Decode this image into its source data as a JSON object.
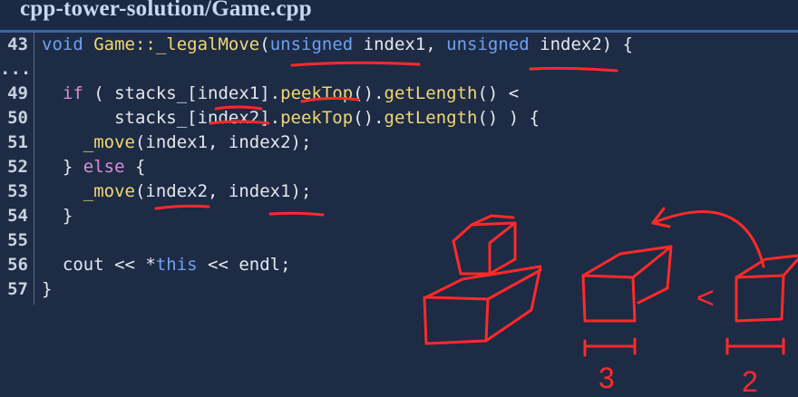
{
  "header": {
    "file_title": "cpp-tower-solution/Game.cpp"
  },
  "editor": {
    "lines": [
      {
        "num": "43",
        "tokens": [
          {
            "t": "void",
            "c": "kw"
          },
          {
            "t": " ",
            "c": "pl"
          },
          {
            "t": "Game::_legalMove",
            "c": "fn"
          },
          {
            "t": "(",
            "c": "pl"
          },
          {
            "t": "unsigned",
            "c": "kw"
          },
          {
            "t": " index1, ",
            "c": "pl"
          },
          {
            "t": "unsigned",
            "c": "kw"
          },
          {
            "t": " index2) {",
            "c": "pl"
          }
        ]
      },
      {
        "num": "...",
        "tokens": []
      },
      {
        "num": "49",
        "tokens": [
          {
            "t": "  ",
            "c": "pl"
          },
          {
            "t": "if",
            "c": "cf"
          },
          {
            "t": " ( stacks_[index1].",
            "c": "pl"
          },
          {
            "t": "peekTop",
            "c": "fn"
          },
          {
            "t": "().",
            "c": "pl"
          },
          {
            "t": "getLength",
            "c": "fn"
          },
          {
            "t": "() <",
            "c": "pl"
          }
        ]
      },
      {
        "num": "50",
        "tokens": [
          {
            "t": "       stacks_[index2].",
            "c": "pl"
          },
          {
            "t": "peekTop",
            "c": "fn"
          },
          {
            "t": "().",
            "c": "pl"
          },
          {
            "t": "getLength",
            "c": "fn"
          },
          {
            "t": "() ) {",
            "c": "pl"
          }
        ]
      },
      {
        "num": "51",
        "tokens": [
          {
            "t": "    ",
            "c": "pl"
          },
          {
            "t": "_move",
            "c": "fn"
          },
          {
            "t": "(index1, index2);",
            "c": "pl"
          }
        ]
      },
      {
        "num": "52",
        "tokens": [
          {
            "t": "  } ",
            "c": "pl"
          },
          {
            "t": "else",
            "c": "cf"
          },
          {
            "t": " {",
            "c": "pl"
          }
        ]
      },
      {
        "num": "53",
        "tokens": [
          {
            "t": "    ",
            "c": "pl"
          },
          {
            "t": "_move",
            "c": "fn"
          },
          {
            "t": "(index2, index1);",
            "c": "pl"
          }
        ]
      },
      {
        "num": "54",
        "tokens": [
          {
            "t": "  }",
            "c": "pl"
          }
        ]
      },
      {
        "num": "55",
        "tokens": []
      },
      {
        "num": "56",
        "tokens": [
          {
            "t": "  cout << *",
            "c": "pl"
          },
          {
            "t": "this",
            "c": "kw"
          },
          {
            "t": " << endl;",
            "c": "pl"
          }
        ]
      },
      {
        "num": "57",
        "tokens": [
          {
            "t": "}",
            "c": "pl"
          }
        ]
      }
    ]
  },
  "annotations": {
    "less_than": "<",
    "width_left": "3",
    "width_right": "2",
    "ink_color": "#ff2a2a"
  }
}
